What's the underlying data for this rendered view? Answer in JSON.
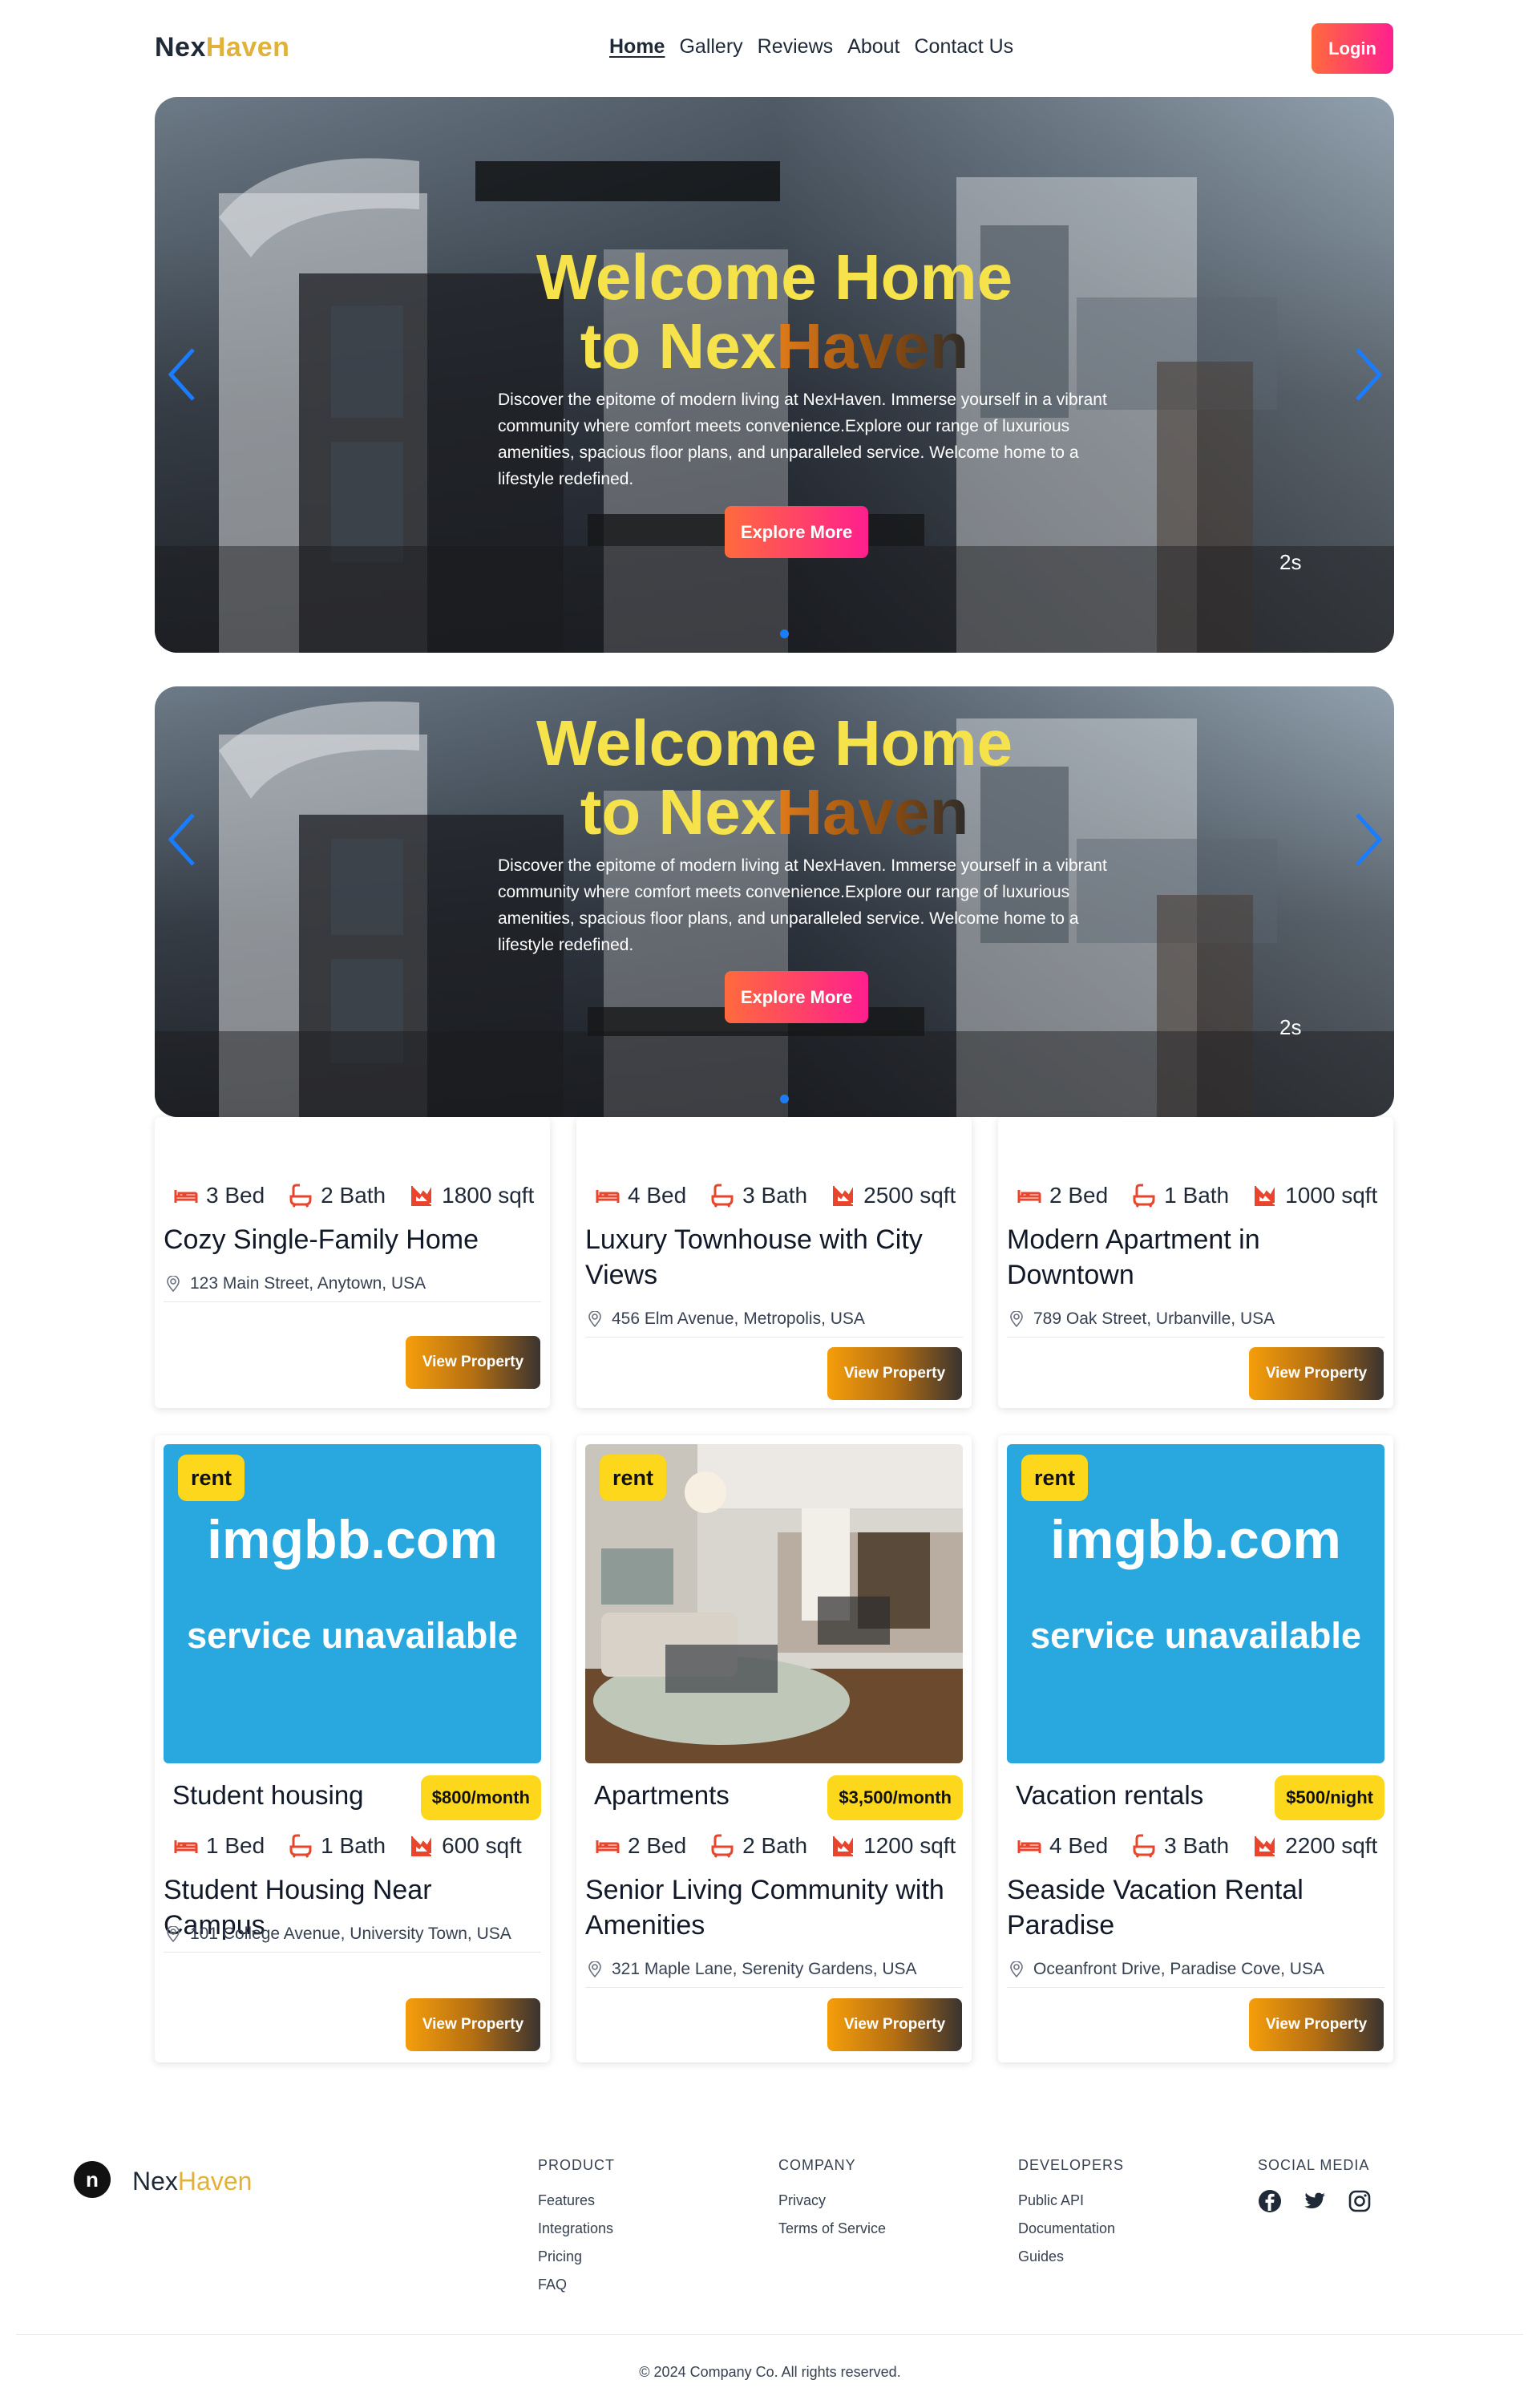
{
  "brand": {
    "part1": "Nex",
    "part2": "Haven"
  },
  "nav": {
    "links": [
      "Home",
      "Gallery",
      "Reviews",
      "About",
      "Contact Us"
    ],
    "login": "Login"
  },
  "hero": {
    "title_line1": "Welcome Home",
    "title_line2_a": "to Nex",
    "title_line2_b": "Haven",
    "text": "Discover the epitome of modern living at NexHaven. Immerse yourself in a vibrant community where comfort meets convenience.Explore our range of luxurious amenities, spacious floor plans, and unparalleled service. Welcome home to a lifestyle redefined.",
    "cta": "Explore More",
    "timer": "2s"
  },
  "top_cards": [
    {
      "beds": "3 Bed",
      "baths": "2 Bath",
      "area": "1800 sqft",
      "title": "Cozy Single-Family Home",
      "address": "123 Main Street, Anytown, USA",
      "button": "View Property"
    },
    {
      "beds": "4 Bed",
      "baths": "3 Bath",
      "area": "2500 sqft",
      "title": "Luxury Townhouse with City Views",
      "address": "456 Elm Avenue, Metropolis, USA",
      "button": "View Property"
    },
    {
      "beds": "2 Bed",
      "baths": "1 Bath",
      "area": "1000 sqft",
      "title": "Modern Apartment in Downtown",
      "address": "789 Oak Street, Urbanville, USA",
      "button": "View Property"
    }
  ],
  "bottom_cards": [
    {
      "status": "rent",
      "placeholder_1": "imgbb.com",
      "placeholder_2": "service unavailable",
      "category": "Student housing",
      "price": "$800/month",
      "beds": "1 Bed",
      "baths": "1 Bath",
      "area": "600 sqft",
      "title": "Student Housing Near Campus",
      "address": "101 College Avenue, University Town, USA",
      "button": "View Property"
    },
    {
      "status": "rent",
      "category": "Apartments",
      "price": "$3,500/month",
      "beds": "2 Bed",
      "baths": "2 Bath",
      "area": "1200 sqft",
      "title": "Senior Living Community with Amenities",
      "address": "321 Maple Lane, Serenity Gardens, USA",
      "button": "View Property"
    },
    {
      "status": "rent",
      "placeholder_1": "imgbb.com",
      "placeholder_2": "service unavailable",
      "category": "Vacation rentals",
      "price": "$500/night",
      "beds": "4 Bed",
      "baths": "3 Bath",
      "area": "2200 sqft",
      "title": "Seaside Vacation Rental Paradise",
      "address": "Oceanfront Drive, Paradise Cove, USA",
      "button": "View Property"
    }
  ],
  "footer": {
    "icon_letter": "n",
    "product": {
      "heading": "PRODUCT",
      "links": [
        "Features",
        "Integrations",
        "Pricing",
        "FAQ"
      ]
    },
    "company": {
      "heading": "COMPANY",
      "links": [
        "Privacy",
        "Terms of Service"
      ]
    },
    "developers": {
      "heading": "DEVELOPERS",
      "links": [
        "Public API",
        "Documentation",
        "Guides"
      ]
    },
    "social": {
      "heading": "SOCIAL MEDIA",
      "icons": [
        "facebook-icon",
        "twitter-icon",
        "instagram-icon"
      ]
    },
    "copyright": "© 2024 Company Co. All rights reserved."
  },
  "colors": {
    "accent_gradient_start": "#ff6a3d",
    "accent_gradient_end": "#ff1f8e",
    "badge_yellow": "#fcd71c",
    "icon_red": "#e8452c",
    "carousel_arrow": "#1a7cff",
    "placeholder_blue": "#29a8e0"
  }
}
